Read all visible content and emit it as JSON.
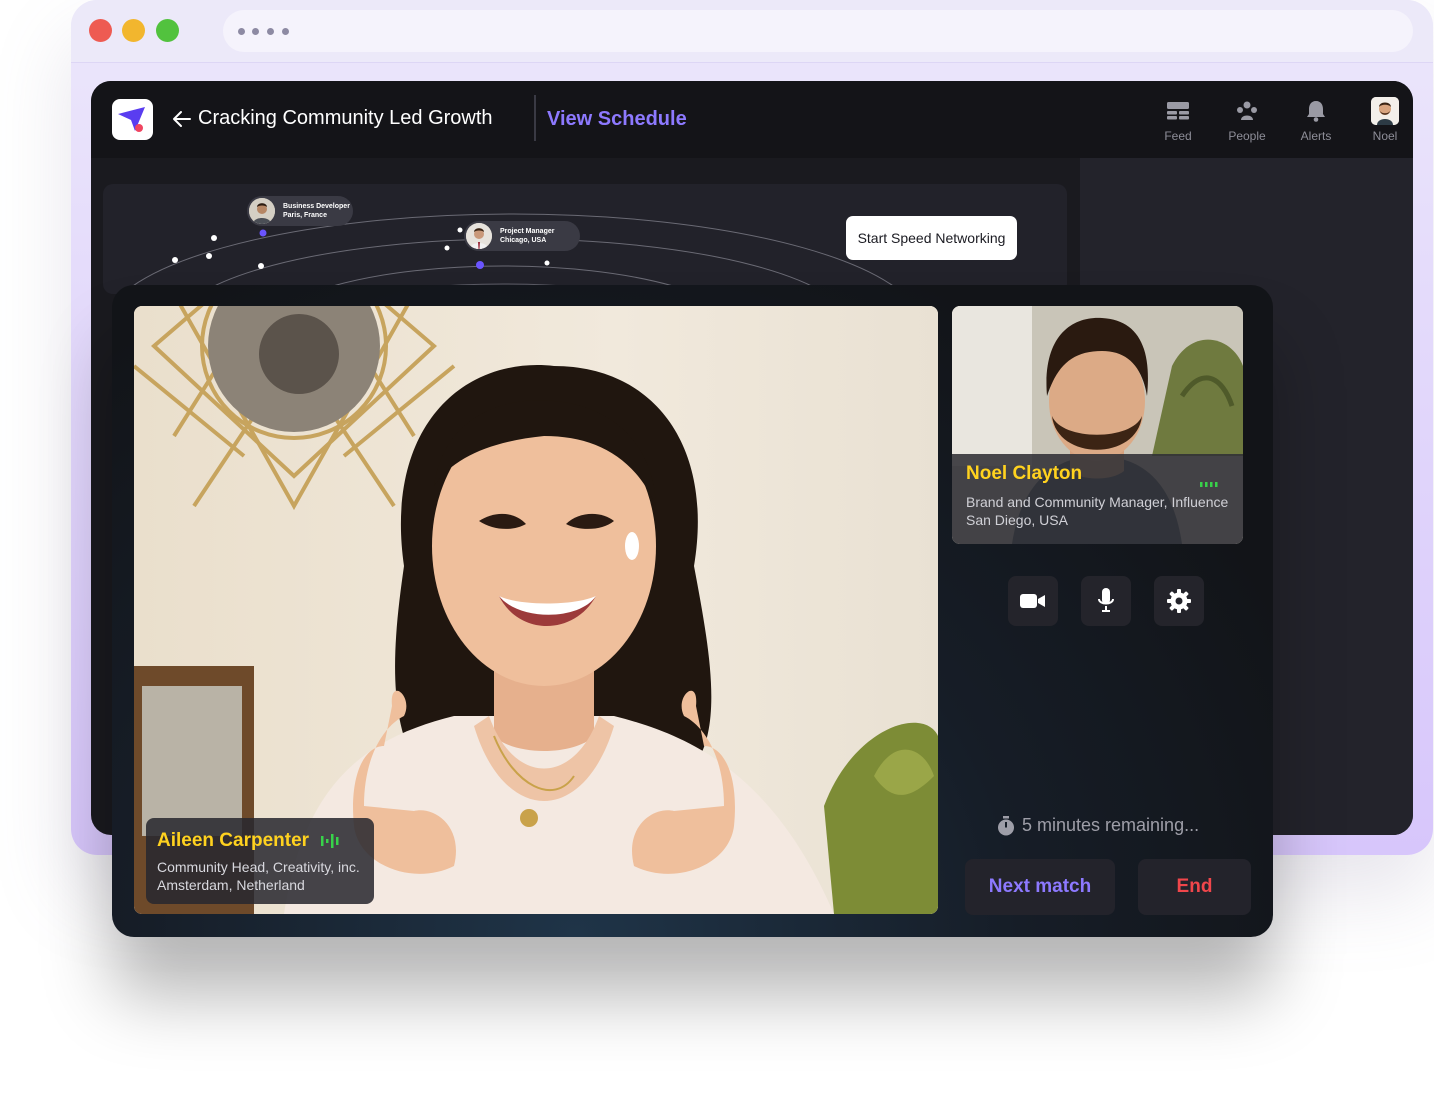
{
  "header": {
    "event_title": "Cracking Community Led Growth",
    "view_schedule": "View Schedule",
    "nav": [
      {
        "label": "Feed",
        "icon": "feed-icon"
      },
      {
        "label": "People",
        "icon": "people-icon"
      },
      {
        "label": "Alerts",
        "icon": "bell-icon"
      },
      {
        "label": "Noel",
        "icon": "avatar"
      }
    ]
  },
  "networking": {
    "start_button": "Start Speed Networking",
    "pins": [
      {
        "role": "Business Developer",
        "location": "Paris, France"
      },
      {
        "role": "Project Manager",
        "location": "Chicago, USA"
      }
    ]
  },
  "call": {
    "main": {
      "name": "Aileen Carpenter",
      "title": "Community Head, Creativity, inc.",
      "location": "Amsterdam, Netherland"
    },
    "side": {
      "name": "Noel Clayton",
      "title": "Brand and Community Manager, Influence",
      "location": "San Diego, USA"
    },
    "controls": [
      "video-camera-icon",
      "microphone-icon",
      "settings-gear-icon"
    ],
    "timer": "5 minutes remaining...",
    "next_match": "Next match",
    "end": "End"
  },
  "colors": {
    "accent": "#8d79ff",
    "name_yellow": "#ffd21f",
    "audio_green": "#38d24a",
    "end_red": "#f0464b"
  }
}
